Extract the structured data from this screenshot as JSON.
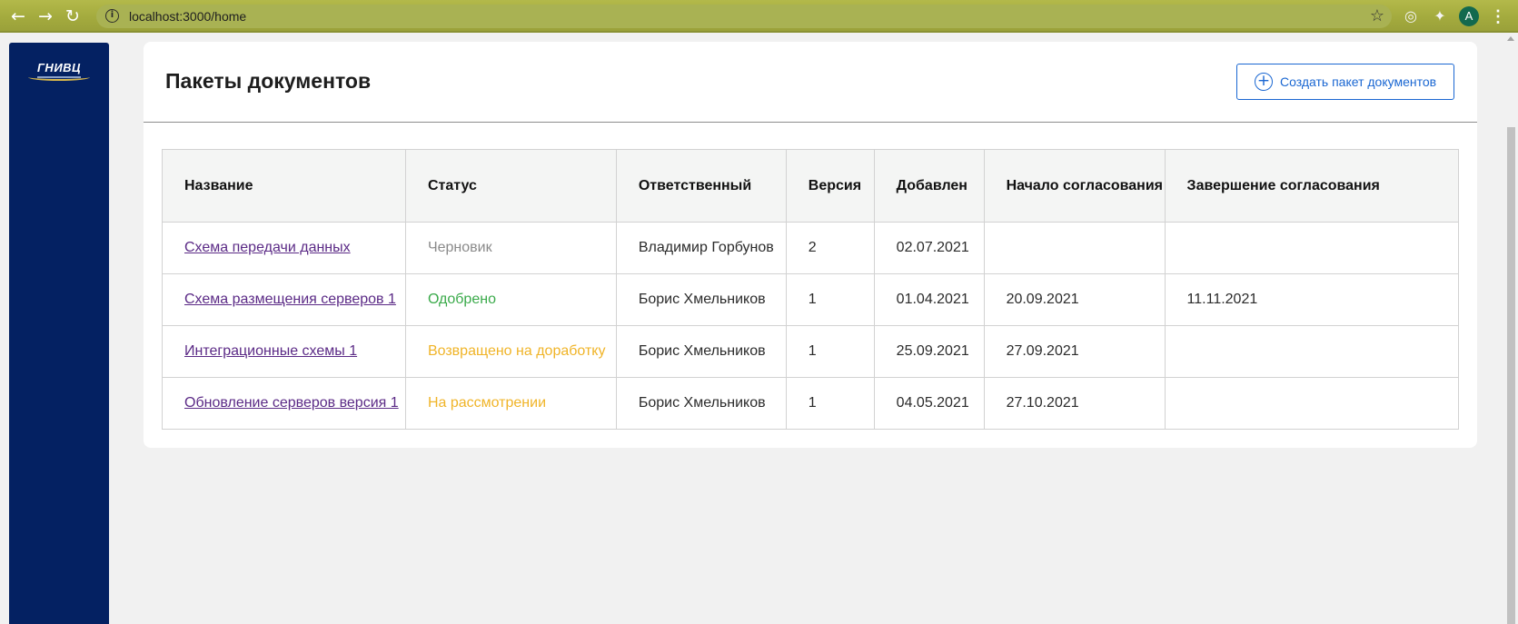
{
  "browser": {
    "url": "localhost:3000/home",
    "avatar_letter": "A",
    "icons": {
      "back": "arrow-left-icon",
      "forward": "arrow-right-icon",
      "reload": "reload-icon",
      "info": "info-icon",
      "star": "star-icon",
      "extension": "extension-icon",
      "puzzle": "puzzle-icon",
      "menu": "kebab-menu-icon"
    }
  },
  "sidebar": {
    "logo_text": "ГНИВЦ",
    "background": "#042162"
  },
  "page": {
    "title": "Пакеты документов",
    "create_button_label": "Создать пакет документов",
    "accent_color": "#1a67d2"
  },
  "table": {
    "columns": [
      "Название",
      "Статус",
      "Ответственный",
      "Версия",
      "Добавлен",
      "Начало согласования",
      "Завершение согласования"
    ],
    "rows": [
      {
        "name": "Схема передачи данных",
        "status": "Черновик",
        "status_color": "#8a8a8a",
        "owner": "Владимир Горбунов",
        "version": "2",
        "added": "02.07.2021",
        "approval_start": "",
        "approval_end": ""
      },
      {
        "name": "Схема размещения серверов 1",
        "status": "Одобрено",
        "status_color": "#3aaa4a",
        "owner": "Борис Хмельников",
        "version": "1",
        "added": "01.04.2021",
        "approval_start": "20.09.2021",
        "approval_end": "11.11.2021"
      },
      {
        "name": "Интеграционные схемы 1",
        "status": "Возвращено на доработку",
        "status_color": "#f0b428",
        "owner": "Борис Хмельников",
        "version": "1",
        "added": "25.09.2021",
        "approval_start": "27.09.2021",
        "approval_end": ""
      },
      {
        "name": "Обновление серверов версия 1",
        "status": "На рассмотрении",
        "status_color": "#f0b428",
        "owner": "Борис Хмельников",
        "version": "1",
        "added": "04.05.2021",
        "approval_start": "27.10.2021",
        "approval_end": ""
      }
    ]
  }
}
